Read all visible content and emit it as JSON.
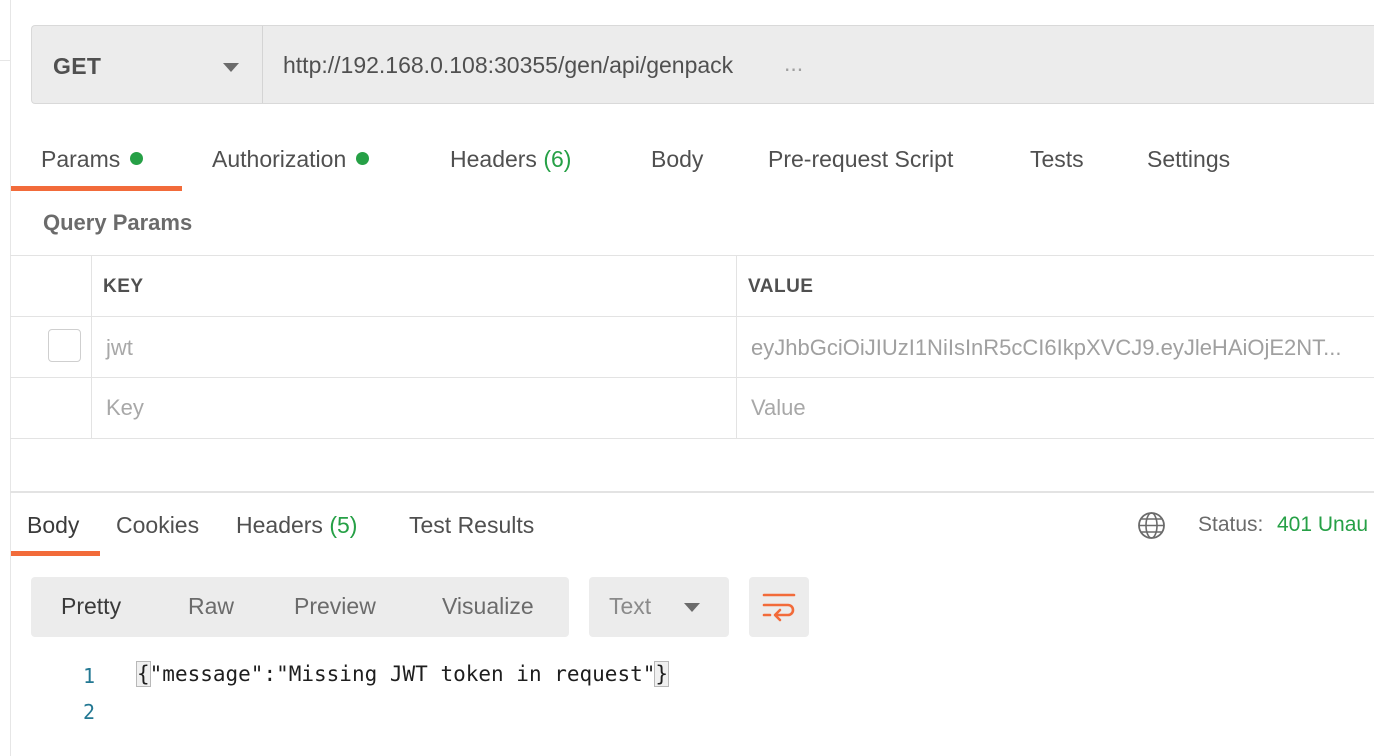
{
  "request": {
    "method": "GET",
    "url": "http://192.168.0.108:30355/gen/api/genpack",
    "url_ellipsis": "..."
  },
  "request_tabs": [
    {
      "label": "Params",
      "dot": true
    },
    {
      "label": "Authorization",
      "dot": true
    },
    {
      "label": "Headers",
      "count": "(6)"
    },
    {
      "label": "Body"
    },
    {
      "label": "Pre-request Script"
    },
    {
      "label": "Tests"
    },
    {
      "label": "Settings"
    }
  ],
  "query_params": {
    "title": "Query Params",
    "headers": {
      "key": "KEY",
      "value": "VALUE"
    },
    "rows": [
      {
        "key": "jwt",
        "value": "eyJhbGciOiJIUzI1NiIsInR5cCI6IkpXVCJ9.eyJleHAiOjE2NT...",
        "checked": false
      }
    ],
    "placeholder": {
      "key": "Key",
      "value": "Value"
    }
  },
  "response_tabs": [
    {
      "label": "Body"
    },
    {
      "label": "Cookies"
    },
    {
      "label": "Headers",
      "count": "(5)"
    },
    {
      "label": "Test Results"
    }
  ],
  "status": {
    "label": "Status:",
    "value": "401 Unau"
  },
  "view_modes": [
    "Pretty",
    "Raw",
    "Preview",
    "Visualize"
  ],
  "format": "Text",
  "code": {
    "line_numbers": [
      "1",
      "2"
    ],
    "open_brace": "{",
    "content": "\"message\":\"Missing JWT token in request\"",
    "close_brace": "}"
  },
  "colors": {
    "accent": "#f26b3a",
    "success": "#26a046"
  },
  "icons": [
    "chevron-down-icon",
    "globe-icon",
    "wrap-lines-icon"
  ]
}
